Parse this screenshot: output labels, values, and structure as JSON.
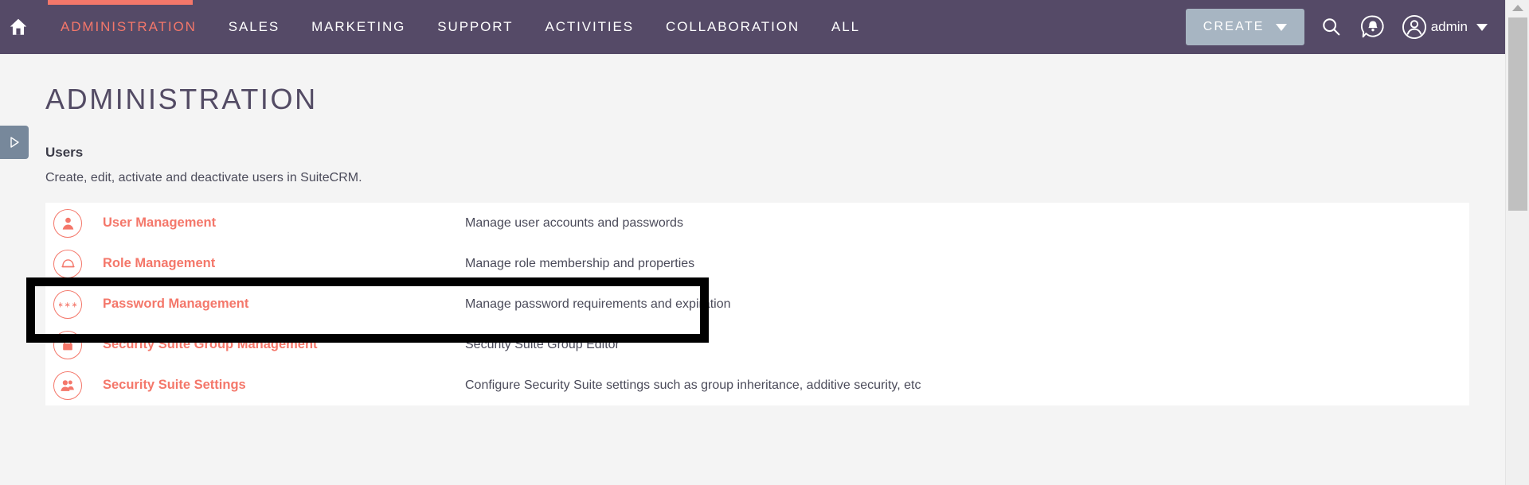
{
  "topnav": {
    "home_icon": "home-icon",
    "items": [
      {
        "label": "ADMINISTRATION",
        "active": true
      },
      {
        "label": "SALES",
        "active": false
      },
      {
        "label": "MARKETING",
        "active": false
      },
      {
        "label": "SUPPORT",
        "active": false
      },
      {
        "label": "ACTIVITIES",
        "active": false
      },
      {
        "label": "COLLABORATION",
        "active": false
      },
      {
        "label": "ALL",
        "active": false
      }
    ],
    "create_label": "CREATE",
    "search_icon": "search-icon",
    "notifications_icon": "notification-bell-icon",
    "avatar_icon": "user-avatar-icon",
    "user_name": "admin",
    "accent_color": "#f4776a",
    "header_color": "#554a67",
    "create_button_color": "#a7b5c2"
  },
  "sidebar_toggle": {
    "icon": "triangle-right-icon",
    "color": "#77889b"
  },
  "main": {
    "page_title": "ADMINISTRATION",
    "section": {
      "heading": "Users",
      "description": "Create, edit, activate and deactivate users in SuiteCRM."
    },
    "rows": [
      {
        "icon": "single-user-icon",
        "label": "User Management",
        "description": "Manage user accounts and passwords",
        "highlighted": true
      },
      {
        "icon": "role-box-icon",
        "label": "Role Management",
        "description": "Manage role membership and properties",
        "highlighted": false
      },
      {
        "icon": "asterisks-password-icon",
        "label": "Password Management",
        "description": "Manage password requirements and expiration",
        "highlighted": false
      },
      {
        "icon": "padlock-icon",
        "label": "Security Suite Group Management",
        "description": "Security Suite Group Editor",
        "highlighted": false
      },
      {
        "icon": "two-users-icon",
        "label": "Security Suite Settings",
        "description": "Configure Security Suite settings such as group inheritance, additive security, etc",
        "highlighted": false
      }
    ]
  },
  "scrollbar": {
    "up_arrow_icon": "scroll-up-arrow-icon",
    "thumb_color": "#c0c0c0"
  }
}
